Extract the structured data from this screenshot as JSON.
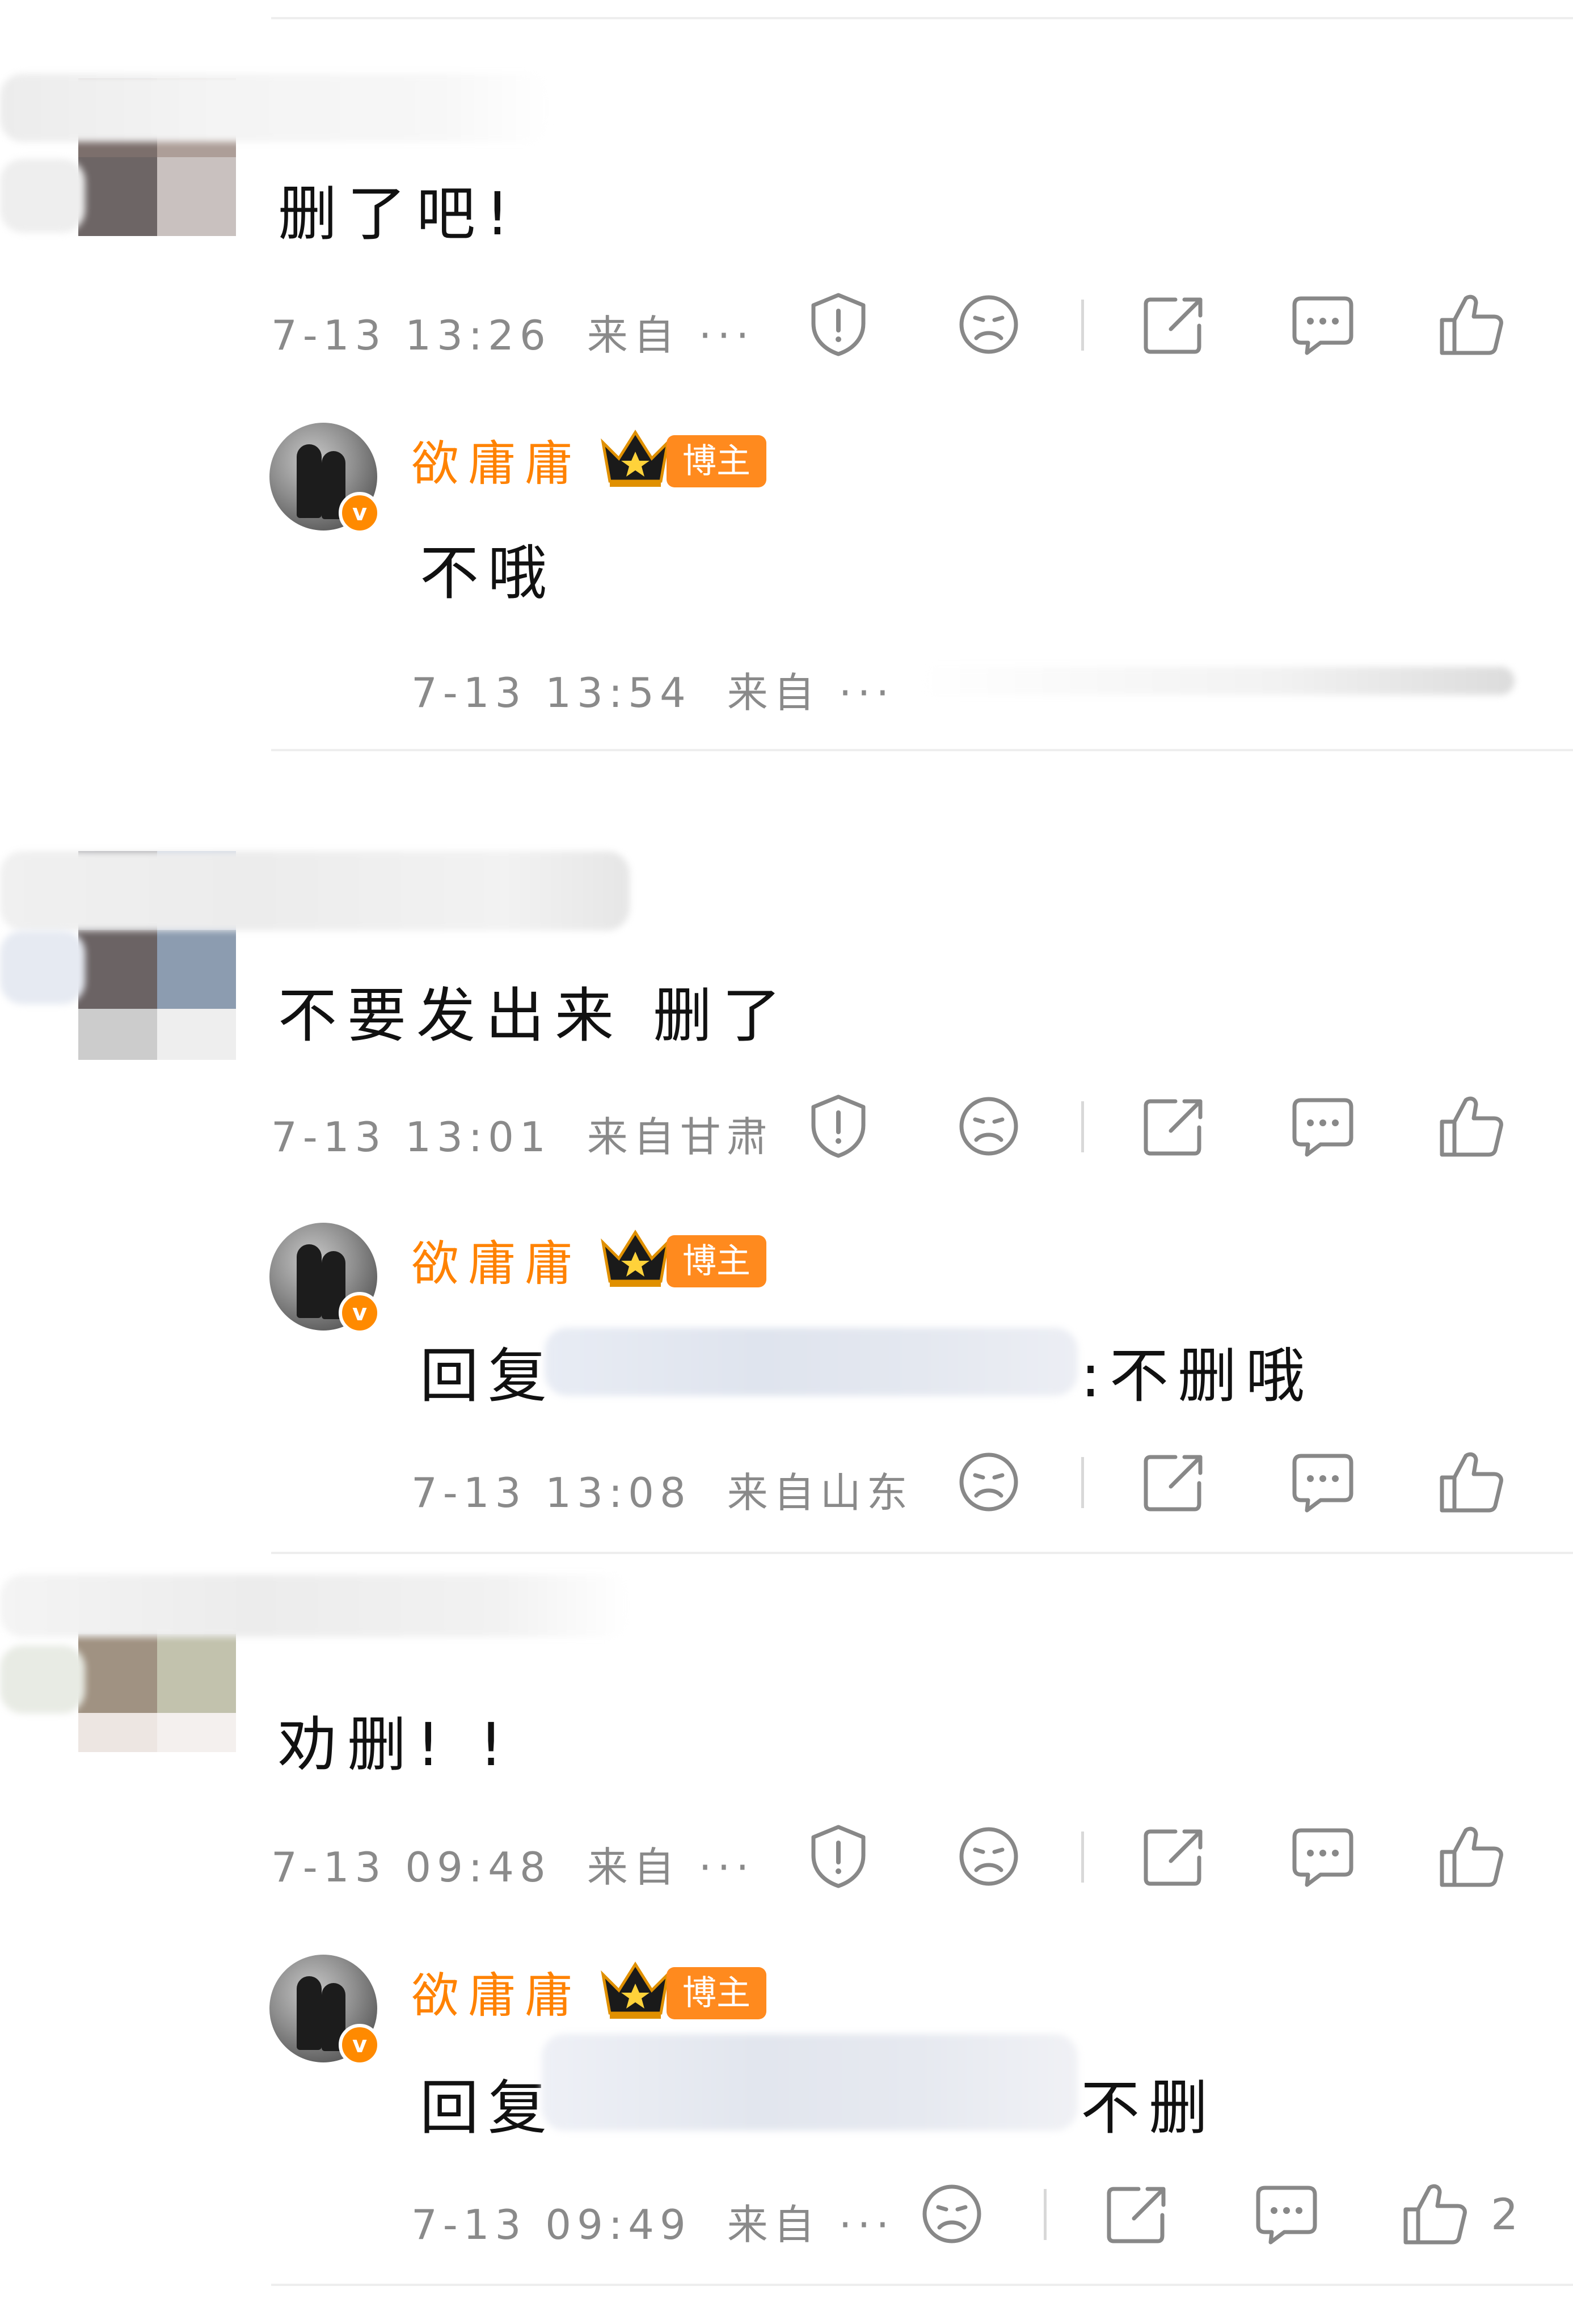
{
  "comments": [
    {
      "text": "删了吧!",
      "time": "7-13 13:26",
      "source": "来自 ···",
      "reply": {
        "username": "欲庸庸",
        "badge": "博主",
        "prefix": "",
        "text": "不哦",
        "time": "7-13 13:54",
        "source": "来自 ···"
      }
    },
    {
      "text": "不要发出来  删了",
      "time": "7-13 13:01",
      "source": "来自甘肃",
      "reply": {
        "username": "欲庸庸",
        "badge": "博主",
        "prefix": "回复",
        "text": ":不删哦",
        "time": "7-13 13:08",
        "source": "来自山东"
      }
    },
    {
      "text": "劝删! !",
      "time": "7-13 09:48",
      "source": "来自 ···",
      "reply": {
        "username": "欲庸庸",
        "badge": "博主",
        "prefix": "回复",
        "text": "不删",
        "time": "7-13 09:49",
        "source": "来自 ···",
        "like_count": "2"
      }
    }
  ],
  "icons": [
    "report-icon",
    "dislike-icon",
    "share-icon",
    "comment-icon",
    "like-icon"
  ],
  "colors": {
    "accent": "#ff8200",
    "meta": "#8a8a8a",
    "icon": "#888888",
    "divider": "#eeeeee"
  }
}
